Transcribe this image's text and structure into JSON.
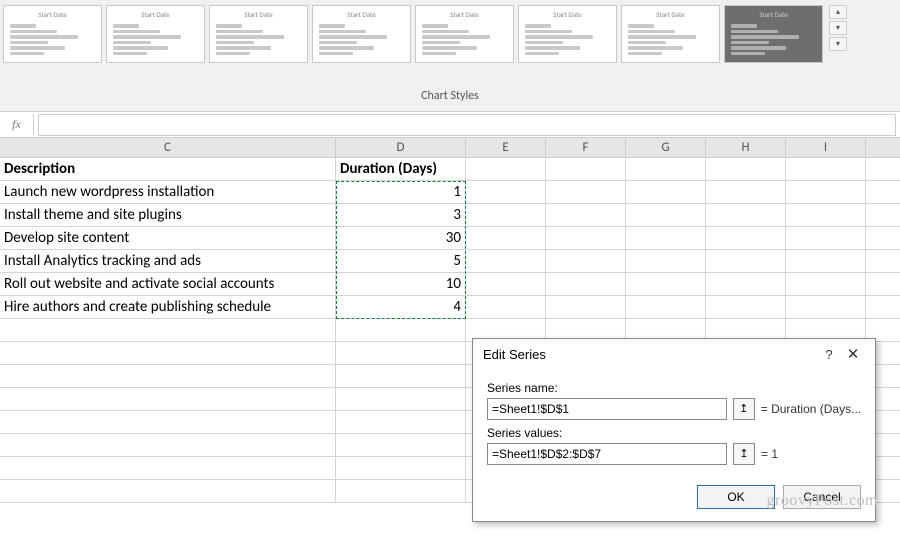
{
  "ribbon": {
    "section_label": "Chart Styles",
    "thumb_title": "Start Date",
    "thumbs": [
      {
        "dark": false
      },
      {
        "dark": false
      },
      {
        "dark": false
      },
      {
        "dark": false
      },
      {
        "dark": false
      },
      {
        "dark": false
      },
      {
        "dark": false
      },
      {
        "dark": true
      }
    ],
    "scroll_up": "▴",
    "scroll_down": "▾",
    "more": "▾"
  },
  "formula_bar": {
    "fx": "fx",
    "value": ""
  },
  "columns": {
    "c": "C",
    "d": "D",
    "e": "E",
    "f": "F",
    "g": "G",
    "h": "H",
    "i": "I"
  },
  "headers": {
    "description": "Description",
    "duration": "Duration (Days)"
  },
  "rows": [
    {
      "desc": "Launch new wordpress installation",
      "dur": "1"
    },
    {
      "desc": "Install theme and site plugins",
      "dur": "3"
    },
    {
      "desc": "Develop site content",
      "dur": "30"
    },
    {
      "desc": "Install Analytics tracking and ads",
      "dur": "5"
    },
    {
      "desc": "Roll out website and activate social accounts",
      "dur": "10"
    },
    {
      "desc": "Hire authors and create publishing schedule",
      "dur": "4"
    }
  ],
  "empty_rows": 8,
  "dialog": {
    "title": "Edit Series",
    "help": "?",
    "close": "✕",
    "label_name": "Series name:",
    "name_value": "=Sheet1!$D$1",
    "name_result": "= Duration (Days...",
    "label_values": "Series values:",
    "values_value": "=Sheet1!$D$2:$D$7",
    "values_result": "= 1",
    "pick_glyph": "↥",
    "ok": "OK",
    "cancel": "Cancel"
  },
  "watermark": "groovyPost.com",
  "chart_data": {
    "type": "bar",
    "title": "Duration (Days)",
    "categories": [
      "Launch new wordpress installation",
      "Install theme and site plugins",
      "Develop site content",
      "Install Analytics tracking and ads",
      "Roll out website and activate social accounts",
      "Hire authors and create publishing schedule"
    ],
    "values": [
      1,
      3,
      30,
      5,
      10,
      4
    ],
    "xlabel": "Duration (Days)",
    "ylabel": "",
    "ylim": [
      0,
      30
    ]
  }
}
